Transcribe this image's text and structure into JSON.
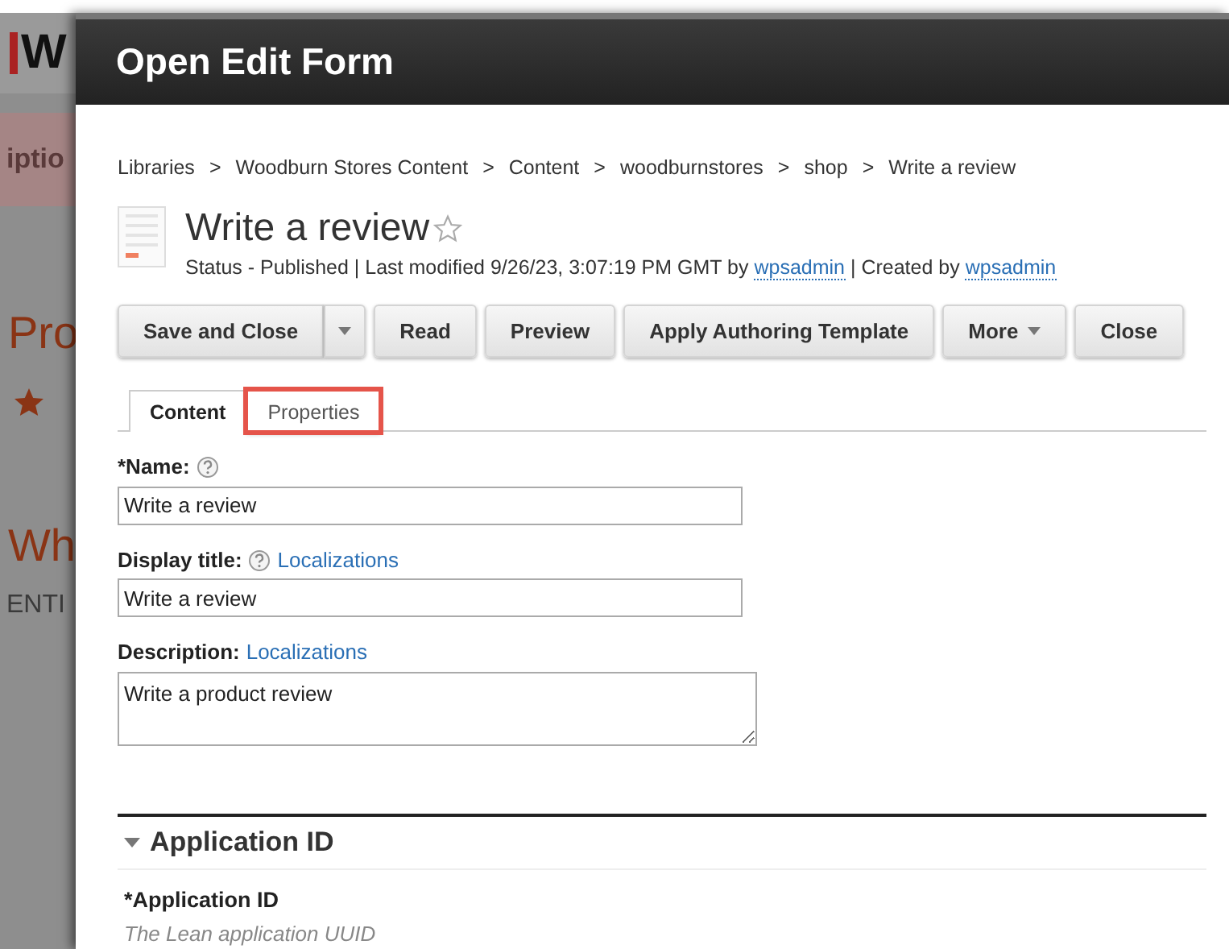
{
  "background_page": {
    "logo": "W",
    "texts": [
      {
        "kind": "tab",
        "text": "iptio"
      },
      {
        "kind": "heading",
        "text": "Pro"
      },
      {
        "kind": "star"
      },
      {
        "kind": "heading",
        "text": "Wh"
      },
      {
        "kind": "caption",
        "text": "ENTI"
      }
    ]
  },
  "dialog": {
    "title": "Open Edit Form"
  },
  "breadcrumb": [
    "Libraries",
    "Woodburn Stores Content",
    "Content",
    "woodburnstores",
    "shop",
    "Write a review"
  ],
  "breadcrumb_separator": ">",
  "item": {
    "title": "Write a review",
    "favorite": false,
    "status_parts": [
      {
        "kind": "text",
        "text": "Status - Published | Last modified 9/26/23, 3:07:19 PM GMT by"
      },
      {
        "kind": "link",
        "text": "wpsadmin"
      },
      {
        "kind": "text",
        "text": "| Created by"
      },
      {
        "kind": "link",
        "text": "wpsadmin"
      }
    ]
  },
  "toolbar": [
    {
      "label": "Save and Close",
      "split": true,
      "caret": false
    },
    {
      "label": "Read",
      "split": false,
      "caret": false
    },
    {
      "label": "Preview",
      "split": false,
      "caret": false
    },
    {
      "label": "Apply Authoring Template",
      "split": false,
      "caret": false
    },
    {
      "label": "More",
      "split": false,
      "caret": true
    },
    {
      "label": "Close",
      "split": false,
      "caret": false
    }
  ],
  "tabs": [
    {
      "label": "Content",
      "selected": true,
      "highlighted": false
    },
    {
      "label": "Properties",
      "selected": false,
      "highlighted": true
    }
  ],
  "fields": [
    {
      "label": "*Name:",
      "help": true,
      "kind": "input",
      "value": "Write a review"
    },
    {
      "label": "Display title:",
      "help": true,
      "link": "Localizations",
      "kind": "input",
      "value": "Write a review"
    },
    {
      "label": "Description:",
      "help": false,
      "link": "Localizations",
      "kind": "textarea",
      "value": "Write a product review"
    }
  ],
  "section": {
    "title": "Application ID",
    "expanded": true,
    "field_label": "*Application ID",
    "hint": "The Lean application UUID"
  }
}
